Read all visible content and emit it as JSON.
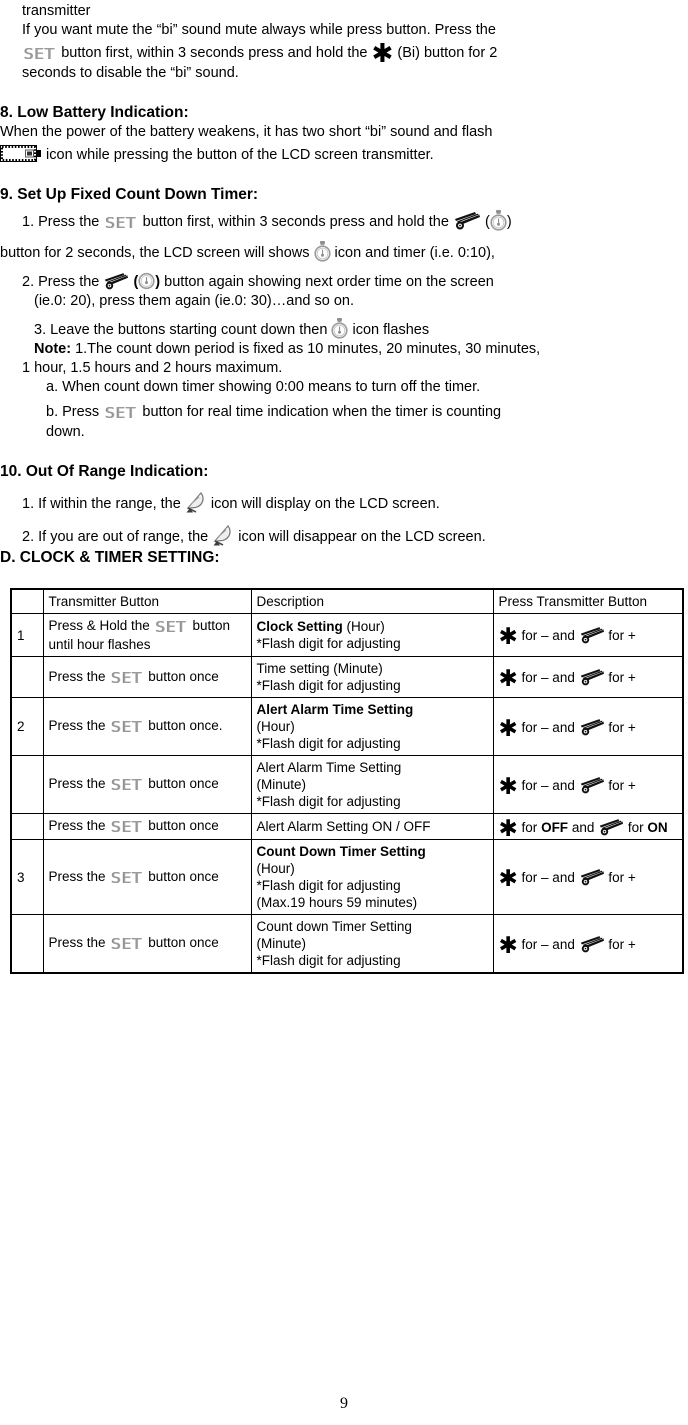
{
  "document": {
    "page_number": "9"
  },
  "intro": {
    "line1": "transmitter",
    "line2": "If you want mute the “bi” sound mute always while press button. Press the",
    "line3_a": "button first, within 3 seconds press and hold the",
    "line3_b": "(Bi) button for 2",
    "line4": "seconds to disable the “bi” sound."
  },
  "section8": {
    "heading": "8. Low Battery Indication:",
    "line1": "When the power of the battery weakens, it has two short “bi” sound and flash",
    "line2": "icon while pressing the button of the LCD screen transmitter."
  },
  "section9": {
    "heading": "9. Set Up Fixed Count Down Timer:",
    "item1_a": "1. Press the",
    "item1_b": "button first, within 3 seconds press and hold the",
    "item1_open": "(",
    "item1_close": ")",
    "item1_c": "button for 2 seconds, the LCD screen will shows",
    "item1_d": "icon and timer (i.e. 0:10),",
    "item2_a": "2. Press the",
    "item2_open": "(",
    "item2_close": ")",
    "item2_b": "button again showing next order time on the screen",
    "item2_c": "(ie.0: 20), press them again (ie.0: 30)…and so on.",
    "item3_a": "3. Leave the buttons starting count down then",
    "item3_b": "icon flashes",
    "note_label": "Note:",
    "note_line1": "1.The count down period is fixed as 10 minutes, 20 minutes, 30 minutes,",
    "note_line2": "1 hour, 1.5 hours and 2 hours maximum.",
    "note_a": "a. When count down timer showing 0:00 means to turn off the timer.",
    "note_b_1": "b. Press",
    "note_b_2": "button for real time indication when the timer is counting",
    "note_b_3": "down."
  },
  "section10": {
    "heading": "10. Out Of Range Indication:",
    "item1_a": "1. If within the range, the",
    "item1_b": "icon will display on the LCD screen.",
    "item2_a": "2. If you are out of range, the",
    "item2_b": "icon will disappear on the LCD screen."
  },
  "sectionD": {
    "heading": "D. CLOCK & TIMER SETTING:"
  },
  "table": {
    "headers": {
      "num": "",
      "transmitter_button": "Transmitter Button",
      "description": "Description",
      "press_transmitter_button": "Press Transmitter Button"
    },
    "rows": [
      {
        "num": "1",
        "btn_pre": "Press & Hold the",
        "btn_post": "button until hour flashes",
        "desc_bold": "Clock Setting",
        "desc_rest": " (Hour)",
        "desc_line2": "*Flash digit for adjusting",
        "desc_line3": "",
        "press_a": "for – and",
        "press_b": "for +",
        "press_mode": "plusminus"
      },
      {
        "num": "",
        "btn_pre": "Press the",
        "btn_post": "button once",
        "desc_bold": "",
        "desc_rest": "Time setting (Minute)",
        "desc_line2": "*Flash digit for adjusting",
        "desc_line3": "",
        "press_a": "for – and",
        "press_b": "for +",
        "press_mode": "plusminus"
      },
      {
        "num": "2",
        "btn_pre": "Press the",
        "btn_post": "button once.",
        "desc_bold": "Alert Alarm Time Setting",
        "desc_rest": "",
        "desc_line2": "(Hour)",
        "desc_line3": "*Flash digit for adjusting",
        "press_a": "for – and",
        "press_b": "for +",
        "press_mode": "plusminus"
      },
      {
        "num": "",
        "btn_pre": "Press the",
        "btn_post": "button once",
        "desc_bold": "",
        "desc_rest": "Alert Alarm Time Setting",
        "desc_line2": "(Minute)",
        "desc_line3": "*Flash digit for adjusting",
        "press_a": "for – and",
        "press_b": "for +",
        "press_mode": "plusminus"
      },
      {
        "num": "",
        "btn_pre": "Press the",
        "btn_post": "button once",
        "desc_bold": "",
        "desc_rest": "Alert Alarm Setting ON / OFF",
        "desc_line2": "",
        "desc_line3": "",
        "press_a": "for OFF and",
        "press_b": "for ON",
        "press_mode": "onoff"
      },
      {
        "num": "3",
        "btn_pre": "Press the",
        "btn_post": "button once",
        "desc_bold": "Count Down Timer Setting",
        "desc_rest": "",
        "desc_line2": "(Hour)",
        "desc_line3": "*Flash digit for adjusting",
        "desc_line4": "(Max.19 hours 59 minutes)",
        "press_a": "for – and",
        "press_b": "for +",
        "press_mode": "plusminus"
      },
      {
        "num": "",
        "btn_pre": "Press the",
        "btn_post": "button once",
        "desc_bold": "",
        "desc_rest": "Count down Timer Setting",
        "desc_line2": "(Minute)",
        "desc_line3": "*Flash digit for adjusting",
        "press_a": "for – and",
        "press_b": "for +",
        "press_mode": "plusminus"
      }
    ]
  },
  "icons": {
    "set_button": "SET",
    "bi_button": "✱",
    "flag_button": "racing-flag-icon",
    "stopwatch": "stopwatch-icon",
    "battery": "low-battery-icon",
    "dish": "satellite-dish-icon"
  }
}
